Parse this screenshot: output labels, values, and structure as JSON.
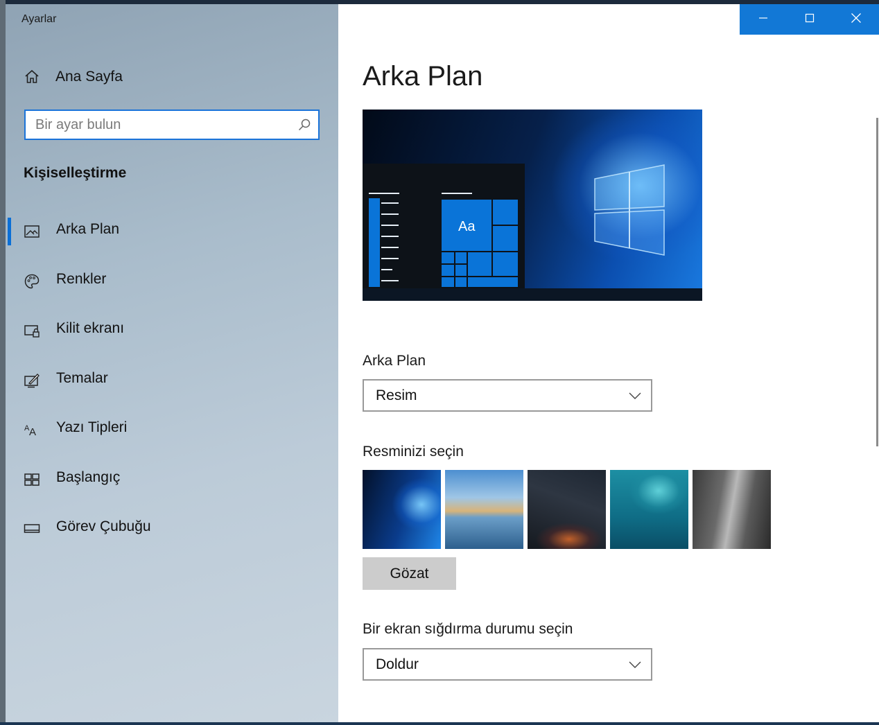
{
  "window": {
    "app_title": "Ayarlar",
    "controls": {
      "minimize": "minimize-icon",
      "maximize": "maximize-icon",
      "close": "close-icon"
    },
    "accent_color": "#1278d6"
  },
  "sidebar": {
    "home": {
      "label": "Ana Sayfa",
      "icon": "home-icon"
    },
    "search": {
      "placeholder": "Bir ayar bulun",
      "value": "",
      "icon": "search-icon"
    },
    "section_title": "Kişiselleştirme",
    "items": [
      {
        "label": "Arka Plan",
        "icon": "picture-icon",
        "active": true
      },
      {
        "label": "Renkler",
        "icon": "palette-icon",
        "active": false
      },
      {
        "label": "Kilit ekranı",
        "icon": "lock-screen-icon",
        "active": false
      },
      {
        "label": "Temalar",
        "icon": "themes-icon",
        "active": false
      },
      {
        "label": "Yazı Tipleri",
        "icon": "fonts-icon",
        "active": false
      },
      {
        "label": "Başlangıç",
        "icon": "start-icon",
        "active": false
      },
      {
        "label": "Görev Çubuğu",
        "icon": "taskbar-icon",
        "active": false
      }
    ]
  },
  "main": {
    "title": "Arka Plan",
    "preview": {
      "tile_text": "Aa"
    },
    "background": {
      "label": "Arka Plan",
      "value": "Resim"
    },
    "choose_picture": {
      "label": "Resminizi seçin",
      "thumbnails": [
        "windows-hero-thumbnail",
        "beach-rocks-thumbnail",
        "night-sky-tent-thumbnail",
        "underwater-swimmer-thumbnail",
        "rock-cliff-thumbnail"
      ]
    },
    "browse_button": "Gözat",
    "fit": {
      "label": "Bir ekran sığdırma durumu seçin",
      "value": "Doldur"
    }
  }
}
